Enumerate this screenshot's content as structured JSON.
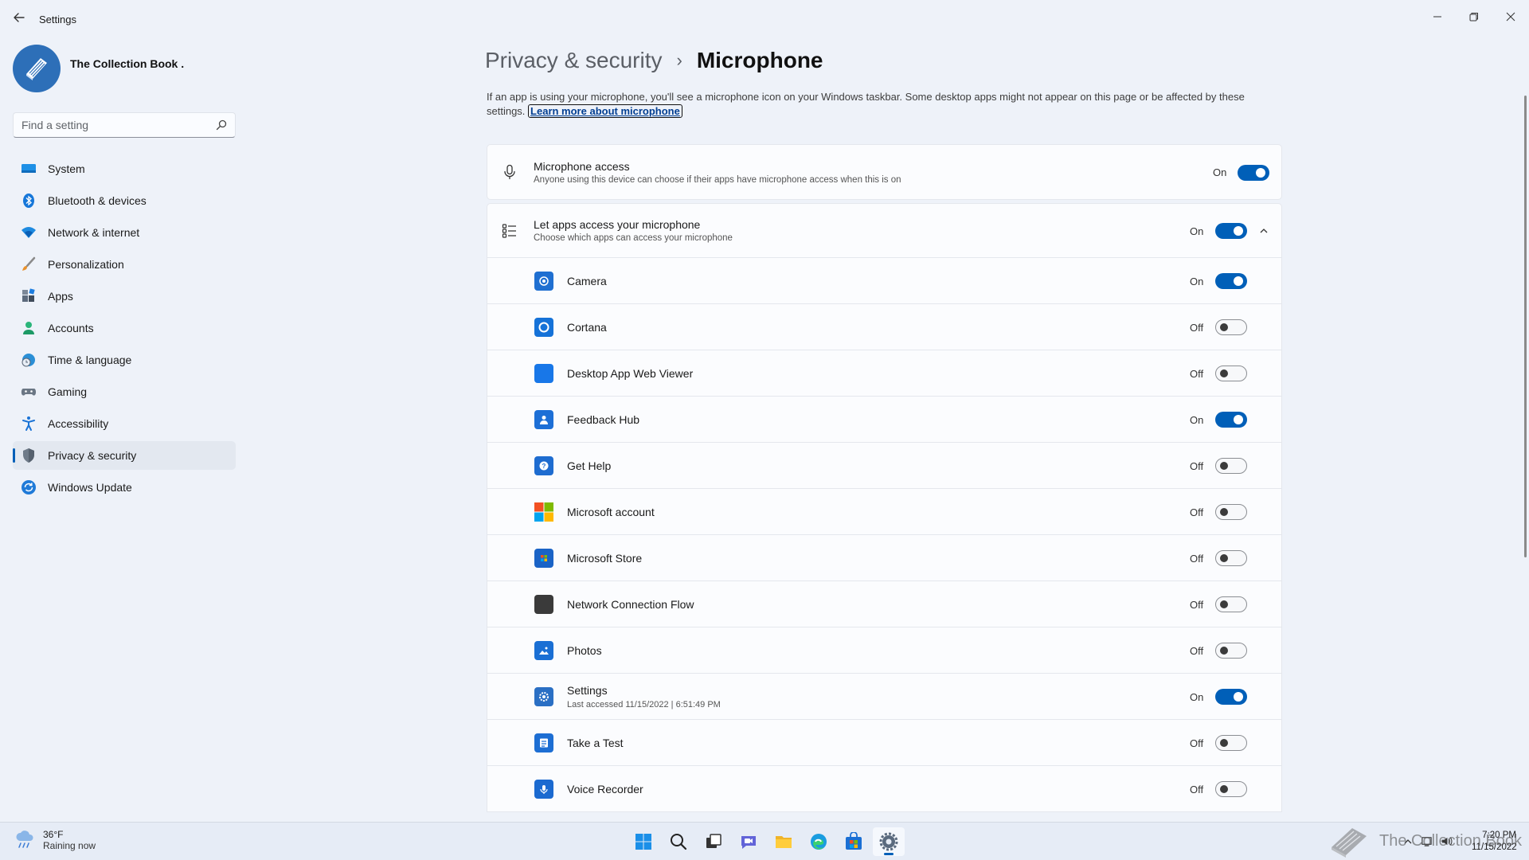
{
  "window": {
    "title": "Settings"
  },
  "profile": {
    "name": "The Collection Book ."
  },
  "search": {
    "placeholder": "Find a setting"
  },
  "nav": [
    {
      "label": "System",
      "icon": "monitor-icon"
    },
    {
      "label": "Bluetooth & devices",
      "icon": "bluetooth-icon"
    },
    {
      "label": "Network & internet",
      "icon": "wifi-icon"
    },
    {
      "label": "Personalization",
      "icon": "brush-icon"
    },
    {
      "label": "Apps",
      "icon": "apps-icon"
    },
    {
      "label": "Accounts",
      "icon": "person-icon"
    },
    {
      "label": "Time & language",
      "icon": "globe-clock-icon"
    },
    {
      "label": "Gaming",
      "icon": "gamepad-icon"
    },
    {
      "label": "Accessibility",
      "icon": "accessibility-icon"
    },
    {
      "label": "Privacy & security",
      "icon": "shield-icon",
      "active": true
    },
    {
      "label": "Windows Update",
      "icon": "update-icon"
    }
  ],
  "breadcrumb": {
    "parent": "Privacy & security",
    "separator": "›",
    "current": "Microphone"
  },
  "description": {
    "text": "If an app is using your microphone, you'll see a microphone icon on your Windows taskbar. Some desktop apps might not appear on this page or be affected by these settings.",
    "link": "Learn more about microphone"
  },
  "microphone_access": {
    "title": "Microphone access",
    "subtitle": "Anyone using this device can choose if their apps have microphone access when this is on",
    "state": "On",
    "on": true
  },
  "let_apps": {
    "title": "Let apps access your microphone",
    "subtitle": "Choose which apps can access your microphone",
    "state": "On",
    "on": true
  },
  "apps": [
    {
      "name": "Camera",
      "state": "On",
      "on": true,
      "icon": "camera-icon",
      "color": "#1f6fd1"
    },
    {
      "name": "Cortana",
      "state": "Off",
      "on": false,
      "icon": "cortana-icon",
      "color": "#1572d8"
    },
    {
      "name": "Desktop App Web Viewer",
      "state": "Off",
      "on": false,
      "icon": "web-viewer-icon",
      "color": "#1877e8"
    },
    {
      "name": "Feedback Hub",
      "state": "On",
      "on": true,
      "icon": "feedback-hub-icon",
      "color": "#1d6fd6"
    },
    {
      "name": "Get Help",
      "state": "Off",
      "on": false,
      "icon": "get-help-icon",
      "color": "#1e6cd0"
    },
    {
      "name": "Microsoft account",
      "state": "Off",
      "on": false,
      "icon": "microsoft-logo-icon",
      "color": "#f25022"
    },
    {
      "name": "Microsoft Store",
      "state": "Off",
      "on": false,
      "icon": "store-icon",
      "color": "#1a63c6"
    },
    {
      "name": "Network Connection Flow",
      "state": "Off",
      "on": false,
      "icon": "network-flow-icon",
      "color": "#3a3a3a"
    },
    {
      "name": "Photos",
      "state": "Off",
      "on": false,
      "icon": "photos-icon",
      "color": "#1a6fd4"
    },
    {
      "name": "Settings",
      "state": "On",
      "on": true,
      "icon": "settings-gear-icon",
      "color": "#2a6fc4",
      "subtitle": "Last accessed 11/15/2022  |  6:51:49 PM"
    },
    {
      "name": "Take a Test",
      "state": "Off",
      "on": false,
      "icon": "take-a-test-icon",
      "color": "#1d6ed3"
    },
    {
      "name": "Voice Recorder",
      "state": "Off",
      "on": false,
      "icon": "voice-recorder-icon",
      "color": "#1b6ad0"
    }
  ],
  "taskbar": {
    "weather_temp": "36°F",
    "weather_desc": "Raining now",
    "apps": [
      {
        "icon": "windows-start-icon"
      },
      {
        "icon": "search-icon"
      },
      {
        "icon": "task-view-icon"
      },
      {
        "icon": "chat-icon"
      },
      {
        "icon": "file-explorer-icon"
      },
      {
        "icon": "edge-icon"
      },
      {
        "icon": "store-icon"
      },
      {
        "icon": "settings-gear-icon",
        "active": true
      }
    ],
    "time": "7:20 PM",
    "date": "11/15/2022",
    "watermark": "The Collection Book"
  },
  "colors": {
    "accent": "#005fb8",
    "background": "#eef2f9",
    "card": "#fbfcfe"
  }
}
